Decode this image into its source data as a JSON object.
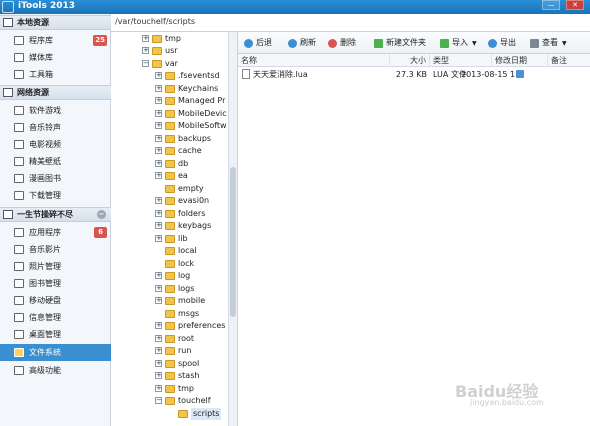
{
  "app": {
    "title": "iTools 2013"
  },
  "path": "/var/touchelf/scripts",
  "sidebar": {
    "groups": [
      {
        "title": "本地资源",
        "items": [
          {
            "label": "程序库",
            "badge": "25",
            "icon": "grid-icon"
          },
          {
            "label": "媒体库",
            "badge": "",
            "icon": "media-icon"
          },
          {
            "label": "工具箱",
            "badge": "",
            "icon": "wrench-icon"
          }
        ]
      },
      {
        "title": "网络资源",
        "items": [
          {
            "label": "软件游戏",
            "icon": "apps-icon"
          },
          {
            "label": "音乐铃声",
            "icon": "music-icon"
          },
          {
            "label": "电影视频",
            "icon": "video-icon"
          },
          {
            "label": "精美壁纸",
            "icon": "wallpaper-icon"
          },
          {
            "label": "漫画图书",
            "icon": "book-icon"
          },
          {
            "label": "下载管理",
            "icon": "download-icon"
          }
        ]
      },
      {
        "title": "一生节操碎不尽",
        "items": [
          {
            "label": "应用程序",
            "badge": "6",
            "icon": "apps-icon"
          },
          {
            "label": "音乐影片",
            "icon": "music-icon"
          },
          {
            "label": "照片管理",
            "icon": "photo-icon"
          },
          {
            "label": "图书管理",
            "icon": "book-icon"
          },
          {
            "label": "移动硬盘",
            "icon": "usb-icon"
          },
          {
            "label": "信息管理",
            "icon": "message-icon"
          },
          {
            "label": "桌面管理",
            "icon": "desktop-icon"
          },
          {
            "label": "文件系统",
            "icon": "folder-icon"
          },
          {
            "label": "高级功能",
            "icon": "advanced-icon"
          }
        ]
      }
    ]
  },
  "tree": [
    {
      "name": "tmp",
      "expander": "+"
    },
    {
      "name": "usr",
      "expander": "+"
    },
    {
      "name": "var",
      "expander": "−"
    },
    {
      "name": ".fseventsd",
      "expander": "+"
    },
    {
      "name": "Keychains",
      "expander": "+"
    },
    {
      "name": "Managed Pr",
      "expander": "+"
    },
    {
      "name": "MobileDevic",
      "expander": "+"
    },
    {
      "name": "MobileSoftw",
      "expander": "+"
    },
    {
      "name": "backups",
      "expander": "+"
    },
    {
      "name": "cache",
      "expander": "+"
    },
    {
      "name": "db",
      "expander": "+"
    },
    {
      "name": "ea",
      "expander": "+"
    },
    {
      "name": "empty",
      "expander": ""
    },
    {
      "name": "evasi0n",
      "expander": "+"
    },
    {
      "name": "folders",
      "expander": "+"
    },
    {
      "name": "keybags",
      "expander": "+"
    },
    {
      "name": "lib",
      "expander": "+"
    },
    {
      "name": "local",
      "expander": ""
    },
    {
      "name": "lock",
      "expander": ""
    },
    {
      "name": "log",
      "expander": "+"
    },
    {
      "name": "logs",
      "expander": "+"
    },
    {
      "name": "mobile",
      "expander": "+"
    },
    {
      "name": "msgs",
      "expander": ""
    },
    {
      "name": "preferences",
      "expander": "+"
    },
    {
      "name": "root",
      "expander": "+"
    },
    {
      "name": "run",
      "expander": "+"
    },
    {
      "name": "spool",
      "expander": "+"
    },
    {
      "name": "stash",
      "expander": "+"
    },
    {
      "name": "tmp",
      "expander": "+"
    },
    {
      "name": "touchelf",
      "expander": "−"
    },
    {
      "name": "scripts",
      "expander": ""
    }
  ],
  "toolbar": {
    "back": "后退",
    "refresh": "刷新",
    "delete": "删除",
    "new_folder": "新建文件夹",
    "import": "导入",
    "export": "导出",
    "view": "查看"
  },
  "columns": {
    "name": "名称",
    "size": "大小",
    "type": "类型",
    "modified": "修改日期",
    "note": "备注"
  },
  "files": [
    {
      "name": "天天爱消除.lua",
      "size": "27.3 KB",
      "type": "LUA 文件",
      "modified": "2013-08-15 1"
    }
  ],
  "watermark": {
    "main": "Baidu经验",
    "sub": "jingyan.baidu.com"
  },
  "window_controls": {
    "minimize": "—",
    "close": "✕"
  }
}
